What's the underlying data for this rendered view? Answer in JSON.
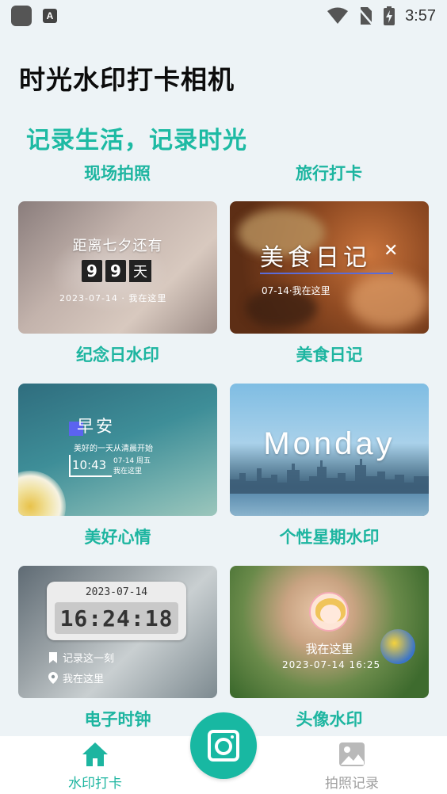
{
  "status_bar": {
    "time": "3:57",
    "badge_letter": "A"
  },
  "app_title": "时光水印打卡相机",
  "slogan": "记录生活，记录时光",
  "top_captions": [
    "现场拍照",
    "旅行打卡"
  ],
  "cards": [
    {
      "caption": "纪念日水印",
      "overlay": {
        "line1": "距离七夕还有",
        "digit1": "9",
        "digit2": "9",
        "unit": "天",
        "footer": "2023-07-14 · 我在这里"
      }
    },
    {
      "caption": "美食日记",
      "overlay": {
        "title": "美食日记",
        "footer": "07-14·我在这里"
      }
    },
    {
      "caption": "美好心情",
      "overlay": {
        "title": "早安",
        "subtitle": "美好的一天从清晨开始",
        "time": "10:43",
        "date": "07-14 周五",
        "place": "我在这里"
      }
    },
    {
      "caption": "个性星期水印",
      "overlay": {
        "title": "Monday"
      }
    },
    {
      "caption": "电子时钟",
      "overlay": {
        "date": "2023-07-14",
        "time": "16:24:18",
        "row1": "记录这一刻",
        "row2": "我在这里"
      }
    },
    {
      "caption": "头像水印",
      "overlay": {
        "place": "我在这里",
        "datetime": "2023-07-14 16:25"
      }
    }
  ],
  "bottom_nav": {
    "left_label": "水印打卡",
    "right_label": "拍照记录"
  },
  "colors": {
    "accent": "#1db5a0",
    "background": "#edf3f6",
    "inactive": "#9e9e9e"
  }
}
